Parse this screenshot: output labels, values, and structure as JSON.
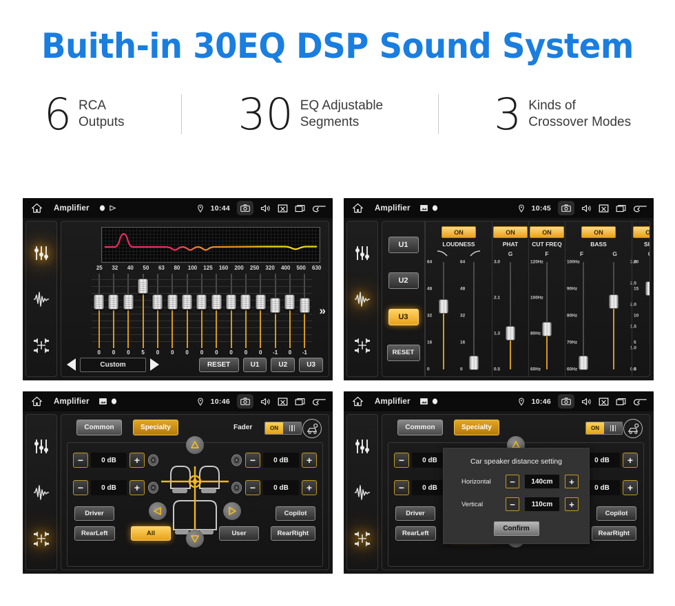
{
  "hero": {
    "title": "Buith-in 30EQ DSP Sound System"
  },
  "stats": [
    {
      "number": "6",
      "line1": "RCA",
      "line2": "Outputs"
    },
    {
      "number": "30",
      "line1": "EQ Adjustable",
      "line2": "Segments"
    },
    {
      "number": "3",
      "line1": "Kinds of",
      "line2": "Crossover Modes"
    }
  ],
  "colors": {
    "accent_blue": "#1a7ee0",
    "amber": "#e8a117",
    "amber_light": "#ffd466",
    "slider_fill": "#d79a22",
    "screen_bg": "#161616"
  },
  "statusbar": {
    "title": "Amplifier",
    "icons": [
      "home-icon",
      "image-icon",
      "record-dot-icon",
      "play-icon",
      "location-pin-icon",
      "camera-icon",
      "volume-icon",
      "close-box-icon",
      "recent-apps-icon",
      "back-arrow-icon"
    ]
  },
  "panel1": {
    "time": "10:44",
    "title": "Amplifier",
    "rail": [
      "equalizer-icon",
      "waveform-icon",
      "balance-icon"
    ],
    "rail_active": 0,
    "frequencies": [
      "25",
      "32",
      "40",
      "50",
      "63",
      "80",
      "100",
      "125",
      "160",
      "200",
      "250",
      "320",
      "400",
      "500",
      "630"
    ],
    "values": [
      "0",
      "0",
      "0",
      "5",
      "0",
      "0",
      "0",
      "0",
      "0",
      "0",
      "0",
      "0",
      "-1",
      "0",
      "-1"
    ],
    "more_chevron": "»",
    "preset": "Custom",
    "buttons": {
      "reset": "RESET",
      "u1": "U1",
      "u2": "U2",
      "u3": "U3"
    },
    "curve": {
      "left_color": "#ee2d63",
      "mid_color": "#f08c1e",
      "right_color": "#f2d618"
    }
  },
  "panel2": {
    "time": "10:45",
    "title": "Amplifier",
    "rail": [
      "equalizer-icon",
      "waveform-icon",
      "balance-icon"
    ],
    "rail_active": 1,
    "presets": [
      {
        "label": "U1",
        "active": false
      },
      {
        "label": "U2",
        "active": false
      },
      {
        "label": "U3",
        "active": true
      },
      {
        "label": "RESET",
        "active": false
      }
    ],
    "columns": [
      {
        "name": "LOUDNESS",
        "state": "ON",
        "sliders": [
          {
            "axis": "curve-down-icon",
            "scale_left": [
              "64",
              "48",
              "32",
              "16",
              "0"
            ],
            "scale_right": [
              "64",
              "48",
              "32",
              "16",
              "0"
            ],
            "knob_pct": 58
          },
          {
            "axis": "curve-up-icon",
            "scale_left": [],
            "scale_right": [],
            "knob_pct": 8
          }
        ]
      },
      {
        "name": "PHAT",
        "state": "ON",
        "sliders": [
          {
            "axis": "G",
            "scale_left": [
              "3.0",
              "2.1",
              "1.3",
              "0.5"
            ],
            "scale_right": [],
            "knob_pct": 34
          }
        ]
      },
      {
        "name": "CUT FREQ",
        "state": "ON",
        "sliders": [
          {
            "axis": "F",
            "scale_left": [
              "120Hz",
              "100Hz",
              "80Hz",
              "60Hz"
            ],
            "scale_right": [],
            "knob_pct": 38
          }
        ]
      },
      {
        "name": "BASS",
        "state": "ON",
        "sliders": [
          {
            "axis": "F",
            "scale_left": [
              "100Hz",
              "90Hz",
              "80Hz",
              "70Hz",
              "60Hz"
            ],
            "scale_right": [],
            "knob_pct": 8
          },
          {
            "axis": "G",
            "scale_left": [],
            "scale_right": [
              "3.0",
              "2.5",
              "2.0",
              "1.5",
              "1.0",
              "0.5"
            ],
            "knob_pct": 62
          }
        ]
      },
      {
        "name": "SUB",
        "state": "ON",
        "sliders": [
          {
            "axis": "G",
            "scale_left": [
              "20",
              "15",
              "10",
              "5",
              "0"
            ],
            "scale_right": [],
            "knob_pct": 74
          }
        ]
      }
    ]
  },
  "panel3": {
    "time": "10:46",
    "title": "Amplifier",
    "rail": [
      "equalizer-icon",
      "waveform-icon",
      "balance-icon"
    ],
    "rail_active": 2,
    "tabs": [
      {
        "label": "Common",
        "active": false
      },
      {
        "label": "Specialty",
        "active": true
      }
    ],
    "fader_label": "Fader",
    "fader_state": "ON",
    "car_settings_icon": "car-seat-settings-icon",
    "steppers": [
      {
        "position": "front-left",
        "value": "0 dB",
        "minus": "−",
        "plus": "+"
      },
      {
        "position": "rear-left",
        "value": "0 dB",
        "minus": "−",
        "plus": "+"
      },
      {
        "position": "front-right",
        "value": "0 dB",
        "minus": "−",
        "plus": "+"
      },
      {
        "position": "rear-right",
        "value": "0 dB",
        "minus": "−",
        "plus": "+"
      }
    ],
    "seat_buttons": [
      {
        "label": "Driver",
        "active": false
      },
      {
        "label": "Copilot",
        "active": false
      },
      {
        "label": "RearLeft",
        "active": false
      },
      {
        "label": "All",
        "active": true
      },
      {
        "label": "User",
        "active": false
      },
      {
        "label": "RearRight",
        "active": false
      }
    ],
    "nav_arrows": [
      "arrow-up-icon",
      "arrow-down-icon",
      "arrow-left-icon",
      "arrow-right-icon"
    ]
  },
  "panel4": {
    "time": "10:46",
    "title": "Amplifier",
    "rail_active": 2,
    "dialog": {
      "title": "Car speaker distance setting",
      "rows": [
        {
          "label": "Horizontal",
          "value": "140cm",
          "minus": "−",
          "plus": "+"
        },
        {
          "label": "Vertical",
          "value": "110cm",
          "minus": "−",
          "plus": "+"
        }
      ],
      "confirm": "Confirm"
    }
  }
}
